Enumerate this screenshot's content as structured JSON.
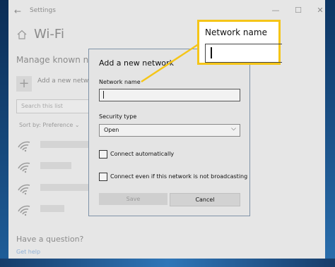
{
  "window": {
    "title": "Settings",
    "back_glyph": "←",
    "minimize_glyph": "—",
    "maximize_glyph": "☐",
    "close_glyph": "✕"
  },
  "page": {
    "title": "Wi-Fi",
    "section_title": "Manage known netw",
    "add_network_label": "Add a new netw",
    "add_icon": "plus-icon",
    "search_placeholder": "Search this list",
    "sort_by": "Sort by: Preference ⌄",
    "networks": [
      {
        "icon": "wifi-icon"
      },
      {
        "icon": "wifi-icon"
      },
      {
        "icon": "wifi-icon"
      },
      {
        "icon": "wifi-icon"
      }
    ],
    "help_title": "Have a question?",
    "help_link": "Get help"
  },
  "dialog": {
    "title": "Add a new network",
    "network_name_label": "Network name",
    "network_name_value": "",
    "security_type_label": "Security type",
    "security_type_value": "Open",
    "connect_auto_label": "Connect automatically",
    "connect_auto_checked": false,
    "connect_hidden_label": "Connect even if this network is not broadcasting",
    "connect_hidden_checked": false,
    "save_label": "Save",
    "cancel_label": "Cancel"
  },
  "callout": {
    "label": "Network name",
    "highlight_color": "#f5c518"
  }
}
